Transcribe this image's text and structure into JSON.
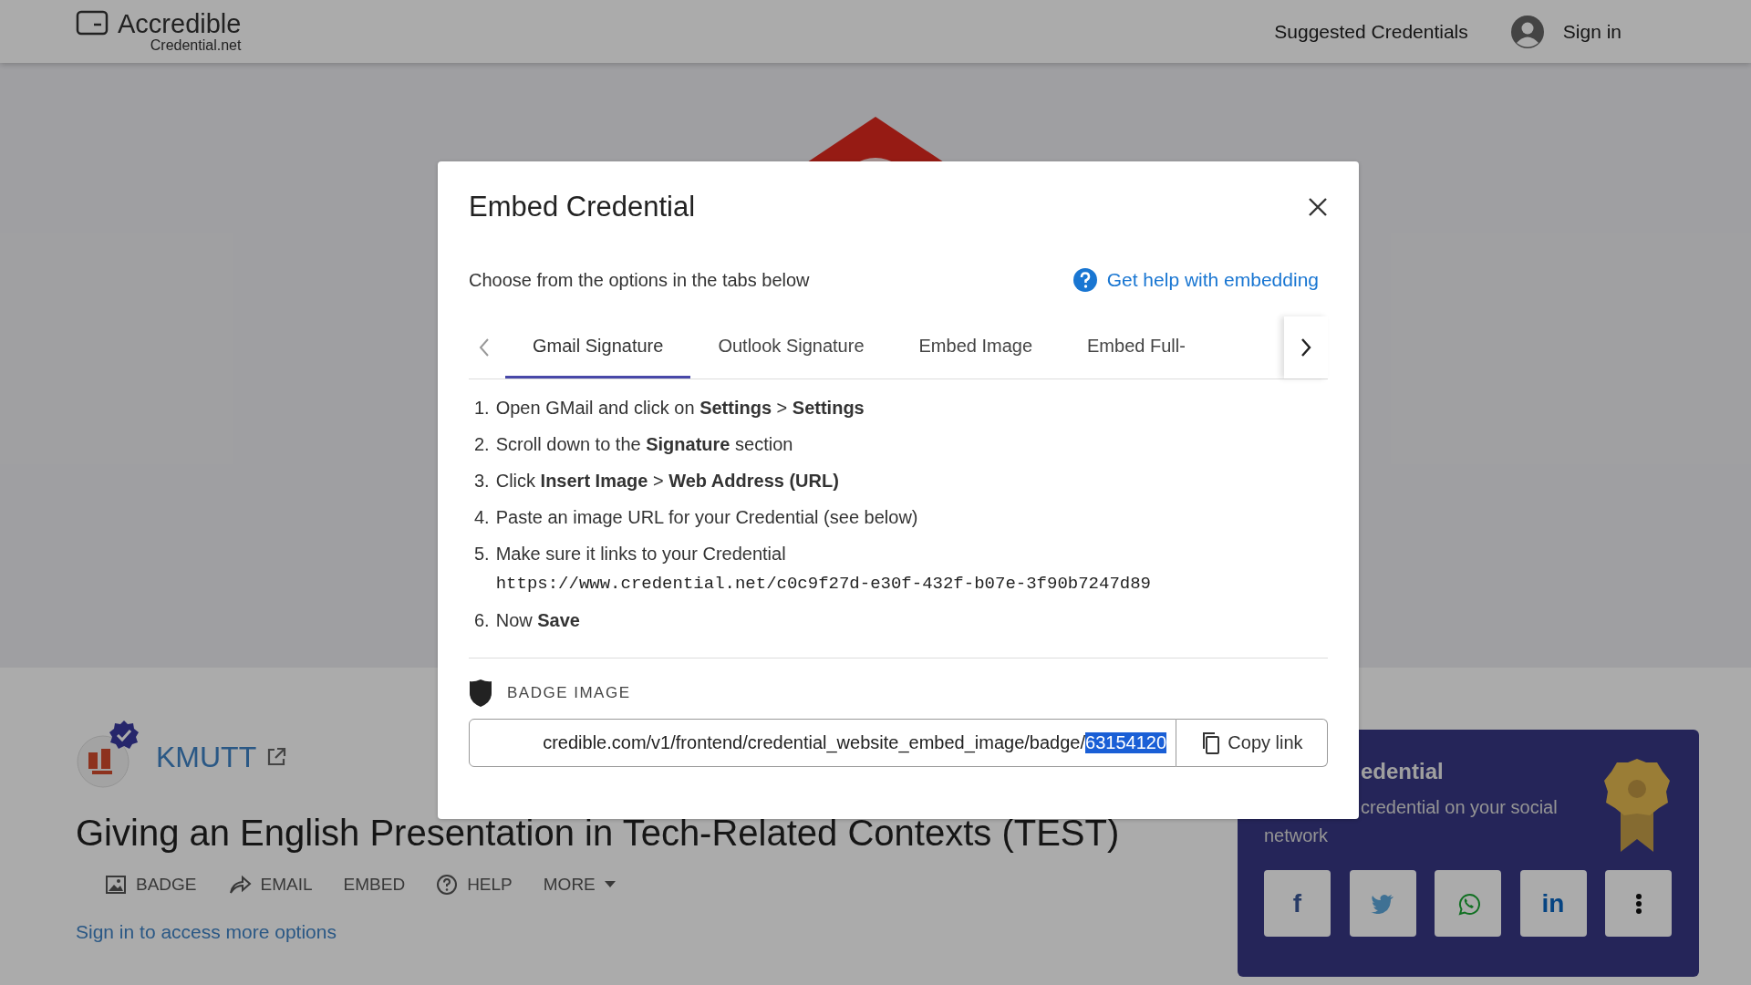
{
  "header": {
    "logo_title": "Accredible",
    "logo_subtitle": "Credential.net",
    "nav_link": "Suggested Credentials",
    "sign_in": "Sign in"
  },
  "issuer": {
    "name": "KMUTT"
  },
  "credential_title": "Giving an English Presentation in Tech-Related Contexts (TEST)",
  "actions": [
    {
      "kind": "image",
      "label": "BADGE"
    },
    {
      "kind": "share",
      "label": "EMAIL"
    },
    {
      "kind": "plain",
      "label": "EMBED"
    },
    {
      "kind": "help",
      "label": "HELP"
    },
    {
      "kind": "menu",
      "label": "MORE"
    }
  ],
  "sign_in_prompt": "Sign in to access more options",
  "share_card": {
    "title": "edential",
    "description_line_1": "credential on your social",
    "description_line_2": "network",
    "buttons": [
      {
        "kind": "facebook",
        "glyph": "f"
      },
      {
        "kind": "twitter"
      },
      {
        "kind": "whatsapp"
      },
      {
        "kind": "linkedin",
        "glyph": "in"
      },
      {
        "kind": "more"
      }
    ]
  },
  "modal": {
    "title": "Embed Credential",
    "intro": "Choose from the options in the tabs below",
    "help_link": "Get help with embedding",
    "tabs": [
      {
        "label": "Gmail Signature",
        "selected": true
      },
      {
        "label": "Outlook Signature",
        "selected": false
      },
      {
        "label": "Embed Image",
        "selected": false
      },
      {
        "label": "Embed Full-",
        "selected": false
      }
    ],
    "steps": [
      {
        "number": "1.",
        "text": "Open GMail and click on **Settings** > **Settings**"
      },
      {
        "number": "2.",
        "text": "Scroll down to the **Signature** section"
      },
      {
        "number": "3.",
        "text": "Click **Insert Image** > **Web Address (URL)**"
      },
      {
        "number": "4.",
        "text": "Paste an image URL for your Credential (see below)"
      },
      {
        "number": "5.",
        "text": "Make sure it links to your Credential",
        "code": "https://www.credential.net/c0c9f27d-e30f-432f-b07e-3f90b7247d89"
      },
      {
        "number": "6.",
        "text": "Now **Save**"
      }
    ],
    "badge_section_label": "BADGE IMAGE",
    "url_field": {
      "value": "credible.com/v1/frontend/credential_website_embed_image/badge/",
      "selected_text": "63154120"
    },
    "copy_button": "Copy link"
  }
}
